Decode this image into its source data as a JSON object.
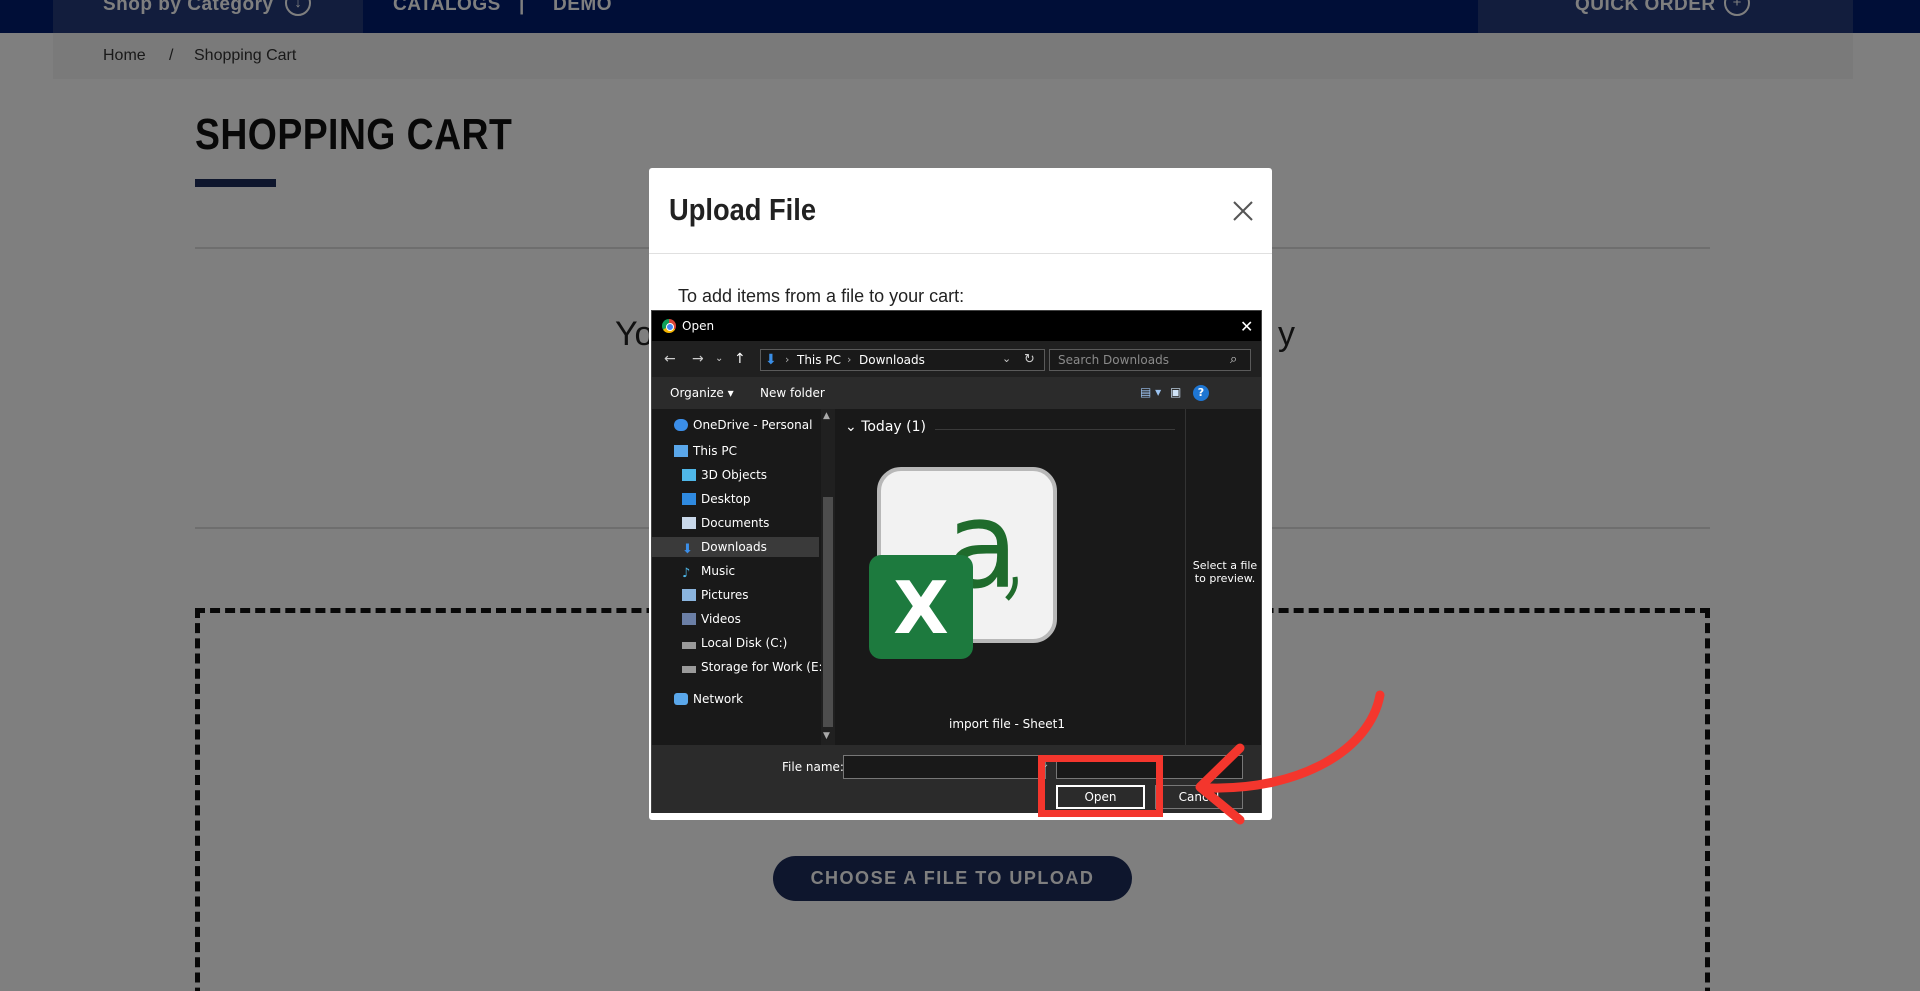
{
  "nav": {
    "shop_by_category": "Shop by Category",
    "catalogs": "CATALOGS",
    "separator": "|",
    "demo": "DEMO",
    "quick_order": "QUICK ORDER"
  },
  "breadcrumb": {
    "home": "Home",
    "separator": "/",
    "current": "Shopping Cart"
  },
  "page": {
    "title": "SHOPPING CART",
    "empty_text_start": "Yo",
    "empty_text_end": "y",
    "choose_file_button": "CHOOSE A FILE TO UPLOAD"
  },
  "modal": {
    "title": "Upload File",
    "instruction": "To add items from a file to your cart:"
  },
  "open_dialog": {
    "title": "Open",
    "address": [
      "This PC",
      "Downloads"
    ],
    "search_placeholder": "Search Downloads",
    "toolbar": {
      "organize": "Organize",
      "new_folder": "New folder"
    },
    "tree": [
      {
        "label": "OneDrive - Personal",
        "icon": "cloud-icon"
      },
      {
        "label": "This PC",
        "icon": "computer-icon"
      },
      {
        "label": "3D Objects",
        "icon": "cube-icon"
      },
      {
        "label": "Desktop",
        "icon": "desktop-icon"
      },
      {
        "label": "Documents",
        "icon": "document-icon"
      },
      {
        "label": "Downloads",
        "icon": "download-icon",
        "selected": true
      },
      {
        "label": "Music",
        "icon": "music-icon"
      },
      {
        "label": "Pictures",
        "icon": "pictures-icon"
      },
      {
        "label": "Videos",
        "icon": "videos-icon"
      },
      {
        "label": "Local Disk (C:)",
        "icon": "drive-icon"
      },
      {
        "label": "Storage for Work (E:)",
        "icon": "drive-icon"
      },
      {
        "label": "Network",
        "icon": "network-icon"
      }
    ],
    "group_header": "Today (1)",
    "file_name": "import file - Sheet1",
    "preview_text": "Select a file to preview.",
    "file_name_label": "File name:",
    "file_name_value": "",
    "open_button": "Open",
    "cancel_button": "Cancel"
  },
  "colors": {
    "nav_bg": "#001d6e",
    "accent": "#1d2c5a",
    "annotation": "#f4362d"
  }
}
